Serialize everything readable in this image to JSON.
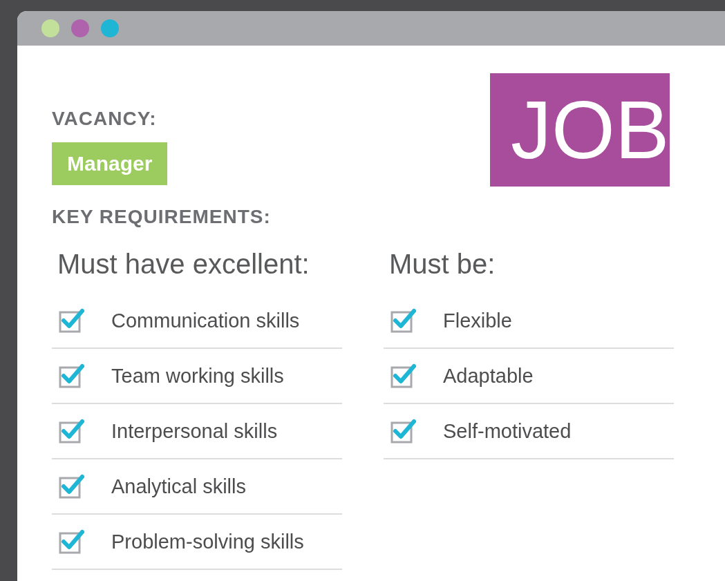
{
  "window": {
    "dots": [
      {
        "color": "#c3e09b"
      },
      {
        "color": "#b063ad"
      },
      {
        "color": "#1fb5d5"
      }
    ]
  },
  "vacancy": {
    "label": "VACANCY:",
    "value": "Manager"
  },
  "badge": "JOB",
  "requirements": {
    "heading": "KEY REQUIREMENTS:",
    "columns": [
      {
        "title": "Must have excellent:",
        "items": [
          {
            "label": "Communication skills",
            "checked": true
          },
          {
            "label": "Team working skills",
            "checked": true
          },
          {
            "label": "Interpersonal skills",
            "checked": true
          },
          {
            "label": "Analytical skills",
            "checked": true
          },
          {
            "label": "Problem-solving skills",
            "checked": true
          }
        ]
      },
      {
        "title": "Must be:",
        "items": [
          {
            "label": "Flexible",
            "checked": true
          },
          {
            "label": "Adaptable",
            "checked": true
          },
          {
            "label": "Self-motivated",
            "checked": true
          }
        ]
      }
    ]
  }
}
